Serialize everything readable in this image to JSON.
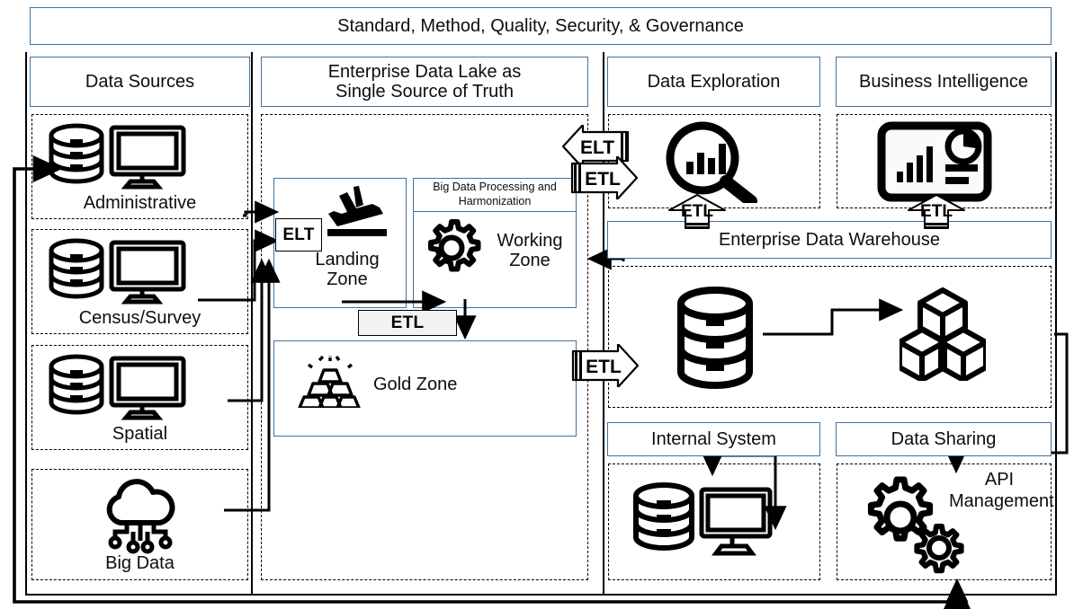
{
  "diagram": {
    "title_banner": "Standard, Method, Quality, Security, & Governance",
    "colors": {
      "header_border": "#41719c",
      "group_border": "#000000",
      "line": "#000000",
      "label_fill": "#f2f2f2",
      "background": "#ffffff"
    }
  },
  "columns": {
    "data_sources": {
      "header": "Data Sources",
      "items": [
        {
          "label": "Administrative",
          "icon": "database-monitor-icon"
        },
        {
          "label": "Census/Survey",
          "icon": "database-monitor-icon"
        },
        {
          "label": "Spatial",
          "icon": "database-monitor-icon"
        },
        {
          "label": "Big Data",
          "icon": "cloud-network-icon"
        }
      ]
    },
    "data_lake": {
      "header": "Enterprise Data Lake as Single Source of Truth",
      "header_line1": "Enterprise Data Lake as",
      "header_line2": "Single Source of Truth",
      "zones": [
        {
          "name": "Landing Zone",
          "icon": "airplane-landing-icon",
          "badge": "ELT"
        },
        {
          "name": "Working Zone",
          "icon": "gear-icon",
          "subheader": "Big Data Processing and Harmonization"
        },
        {
          "name": "Gold Zone",
          "icon": "gold-bars-icon"
        }
      ],
      "internal_etl_label": "ETL"
    },
    "data_exploration": {
      "header": "Data Exploration",
      "icon": "magnifier-bar-chart-icon"
    },
    "business_intelligence": {
      "header": "Business Intelligence",
      "icon": "dashboard-chart-icon"
    }
  },
  "warehouse": {
    "header": "Enterprise Data Warehouse",
    "icons": [
      {
        "name": "database-cylinder-icon"
      },
      {
        "name": "data-marts-cubes-icon"
      }
    ]
  },
  "consumers": {
    "internal_system": {
      "header": "Internal System",
      "icon": "database-monitor-icon"
    },
    "data_sharing": {
      "header": "Data Sharing",
      "icon": "gears-icon",
      "label": "API Management",
      "label_line1": "API",
      "label_line2": "Management"
    }
  },
  "flow_labels": {
    "landing_elt": "ELT",
    "lake_to_exploration_elt": "ELT",
    "exploration_to_lake_etl": "ETL",
    "lake_working_to_gold_etl": "ETL",
    "gold_to_warehouse_etl": "ETL",
    "warehouse_to_exploration_etl": "ETL",
    "warehouse_to_bi_etl": "ETL"
  }
}
